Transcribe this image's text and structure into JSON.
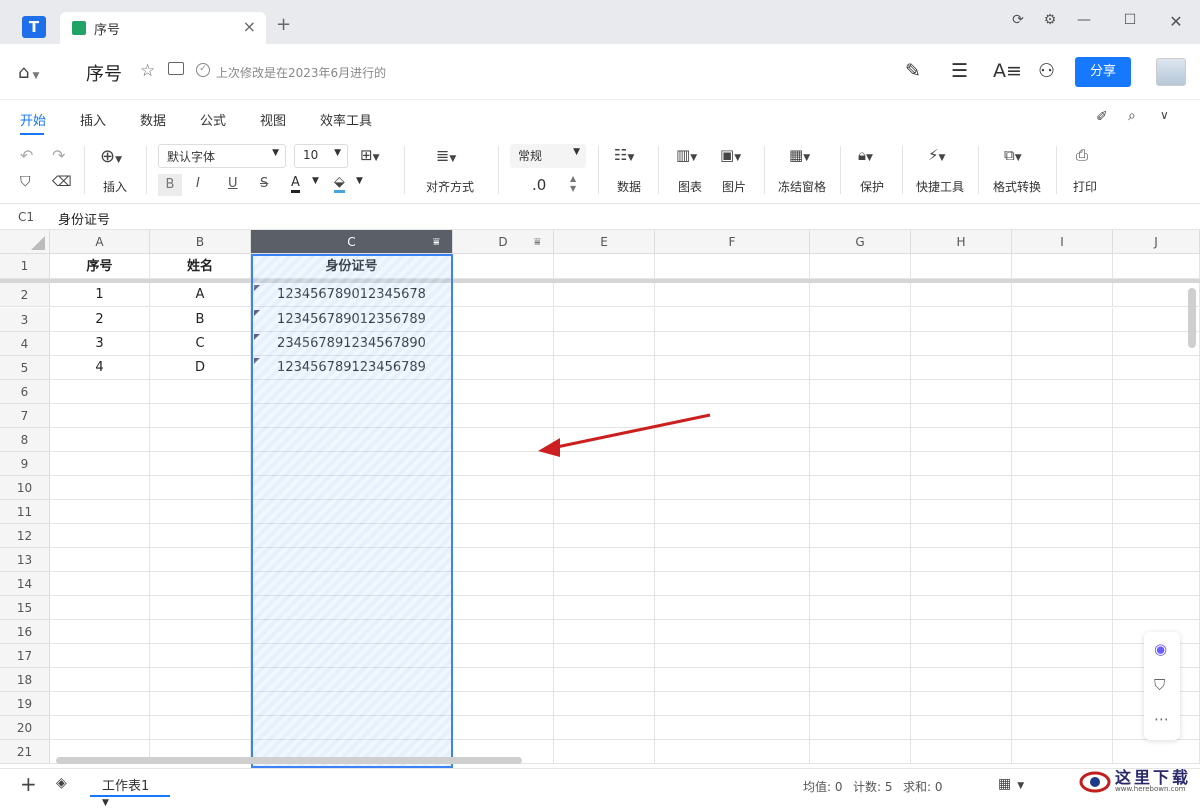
{
  "titlebar": {
    "tab_title": "序号",
    "new_tab_icon": "plus-icon",
    "close_icon": "close-icon"
  },
  "header": {
    "doc_name": "序号",
    "last_modified": "上次修改是在2023年6月进行的",
    "share_label": "分享"
  },
  "menu": {
    "items": [
      "开始",
      "插入",
      "数据",
      "公式",
      "视图",
      "效率工具"
    ],
    "active": "开始"
  },
  "ribbon": {
    "insert_label": "插入",
    "font_name": "默认字体",
    "font_size": "10",
    "align_label": "对齐方式",
    "number_format": "常规",
    "decimal_label": ".0",
    "data_label": "数据",
    "chart_label": "图表",
    "image_label": "图片",
    "freeze_label": "冻结窗格",
    "protect_label": "保护",
    "quick_tools_label": "快捷工具",
    "format_convert_label": "格式转换",
    "print_label": "打印",
    "bold": "B",
    "italic": "I",
    "underline": "U",
    "strike": "S",
    "font_color": "A"
  },
  "formula_bar": {
    "cell_ref": "C1",
    "value": "身份证号"
  },
  "grid": {
    "columns": [
      "A",
      "B",
      "C",
      "D",
      "E",
      "F",
      "G",
      "H",
      "I",
      "J"
    ],
    "selected_column": "C",
    "row_numbers": [
      "1",
      "2",
      "3",
      "4",
      "5",
      "6",
      "7",
      "8",
      "9",
      "10",
      "11",
      "12",
      "13",
      "14",
      "15",
      "16",
      "17",
      "18",
      "19",
      "20",
      "21"
    ],
    "headers": [
      "序号",
      "姓名",
      "身份证号"
    ],
    "rows": [
      [
        "1",
        "A",
        "123456789012345678"
      ],
      [
        "2",
        "B",
        "123456789012356789"
      ],
      [
        "3",
        "C",
        "234567891234567890"
      ],
      [
        "4",
        "D",
        "123456789123456789"
      ]
    ]
  },
  "bottom": {
    "sheet_name": "工作表1",
    "avg": "均值: 0",
    "count": "计数: 5",
    "sum": "求和: 0"
  },
  "watermark": {
    "text": "这里下载",
    "url_text": "www.herebown.com"
  },
  "colors": {
    "accent": "#1677ff",
    "selection_border": "#3b82f6",
    "header_selected": "#5b6068",
    "sheet_green": "#21a366",
    "annotation_arrow": "#cc1f1f"
  }
}
